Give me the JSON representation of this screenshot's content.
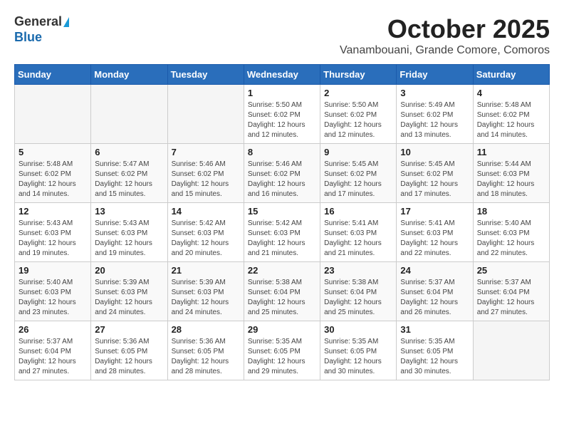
{
  "header": {
    "logo_general": "General",
    "logo_blue": "Blue",
    "month": "October 2025",
    "location": "Vanambouani, Grande Comore, Comoros"
  },
  "weekdays": [
    "Sunday",
    "Monday",
    "Tuesday",
    "Wednesday",
    "Thursday",
    "Friday",
    "Saturday"
  ],
  "weeks": [
    [
      {
        "day": "",
        "info": ""
      },
      {
        "day": "",
        "info": ""
      },
      {
        "day": "",
        "info": ""
      },
      {
        "day": "1",
        "info": "Sunrise: 5:50 AM\nSunset: 6:02 PM\nDaylight: 12 hours\nand 12 minutes."
      },
      {
        "day": "2",
        "info": "Sunrise: 5:50 AM\nSunset: 6:02 PM\nDaylight: 12 hours\nand 12 minutes."
      },
      {
        "day": "3",
        "info": "Sunrise: 5:49 AM\nSunset: 6:02 PM\nDaylight: 12 hours\nand 13 minutes."
      },
      {
        "day": "4",
        "info": "Sunrise: 5:48 AM\nSunset: 6:02 PM\nDaylight: 12 hours\nand 14 minutes."
      }
    ],
    [
      {
        "day": "5",
        "info": "Sunrise: 5:48 AM\nSunset: 6:02 PM\nDaylight: 12 hours\nand 14 minutes."
      },
      {
        "day": "6",
        "info": "Sunrise: 5:47 AM\nSunset: 6:02 PM\nDaylight: 12 hours\nand 15 minutes."
      },
      {
        "day": "7",
        "info": "Sunrise: 5:46 AM\nSunset: 6:02 PM\nDaylight: 12 hours\nand 15 minutes."
      },
      {
        "day": "8",
        "info": "Sunrise: 5:46 AM\nSunset: 6:02 PM\nDaylight: 12 hours\nand 16 minutes."
      },
      {
        "day": "9",
        "info": "Sunrise: 5:45 AM\nSunset: 6:02 PM\nDaylight: 12 hours\nand 17 minutes."
      },
      {
        "day": "10",
        "info": "Sunrise: 5:45 AM\nSunset: 6:02 PM\nDaylight: 12 hours\nand 17 minutes."
      },
      {
        "day": "11",
        "info": "Sunrise: 5:44 AM\nSunset: 6:03 PM\nDaylight: 12 hours\nand 18 minutes."
      }
    ],
    [
      {
        "day": "12",
        "info": "Sunrise: 5:43 AM\nSunset: 6:03 PM\nDaylight: 12 hours\nand 19 minutes."
      },
      {
        "day": "13",
        "info": "Sunrise: 5:43 AM\nSunset: 6:03 PM\nDaylight: 12 hours\nand 19 minutes."
      },
      {
        "day": "14",
        "info": "Sunrise: 5:42 AM\nSunset: 6:03 PM\nDaylight: 12 hours\nand 20 minutes."
      },
      {
        "day": "15",
        "info": "Sunrise: 5:42 AM\nSunset: 6:03 PM\nDaylight: 12 hours\nand 21 minutes."
      },
      {
        "day": "16",
        "info": "Sunrise: 5:41 AM\nSunset: 6:03 PM\nDaylight: 12 hours\nand 21 minutes."
      },
      {
        "day": "17",
        "info": "Sunrise: 5:41 AM\nSunset: 6:03 PM\nDaylight: 12 hours\nand 22 minutes."
      },
      {
        "day": "18",
        "info": "Sunrise: 5:40 AM\nSunset: 6:03 PM\nDaylight: 12 hours\nand 22 minutes."
      }
    ],
    [
      {
        "day": "19",
        "info": "Sunrise: 5:40 AM\nSunset: 6:03 PM\nDaylight: 12 hours\nand 23 minutes."
      },
      {
        "day": "20",
        "info": "Sunrise: 5:39 AM\nSunset: 6:03 PM\nDaylight: 12 hours\nand 24 minutes."
      },
      {
        "day": "21",
        "info": "Sunrise: 5:39 AM\nSunset: 6:03 PM\nDaylight: 12 hours\nand 24 minutes."
      },
      {
        "day": "22",
        "info": "Sunrise: 5:38 AM\nSunset: 6:04 PM\nDaylight: 12 hours\nand 25 minutes."
      },
      {
        "day": "23",
        "info": "Sunrise: 5:38 AM\nSunset: 6:04 PM\nDaylight: 12 hours\nand 25 minutes."
      },
      {
        "day": "24",
        "info": "Sunrise: 5:37 AM\nSunset: 6:04 PM\nDaylight: 12 hours\nand 26 minutes."
      },
      {
        "day": "25",
        "info": "Sunrise: 5:37 AM\nSunset: 6:04 PM\nDaylight: 12 hours\nand 27 minutes."
      }
    ],
    [
      {
        "day": "26",
        "info": "Sunrise: 5:37 AM\nSunset: 6:04 PM\nDaylight: 12 hours\nand 27 minutes."
      },
      {
        "day": "27",
        "info": "Sunrise: 5:36 AM\nSunset: 6:05 PM\nDaylight: 12 hours\nand 28 minutes."
      },
      {
        "day": "28",
        "info": "Sunrise: 5:36 AM\nSunset: 6:05 PM\nDaylight: 12 hours\nand 28 minutes."
      },
      {
        "day": "29",
        "info": "Sunrise: 5:35 AM\nSunset: 6:05 PM\nDaylight: 12 hours\nand 29 minutes."
      },
      {
        "day": "30",
        "info": "Sunrise: 5:35 AM\nSunset: 6:05 PM\nDaylight: 12 hours\nand 30 minutes."
      },
      {
        "day": "31",
        "info": "Sunrise: 5:35 AM\nSunset: 6:05 PM\nDaylight: 12 hours\nand 30 minutes."
      },
      {
        "day": "",
        "info": ""
      }
    ]
  ]
}
